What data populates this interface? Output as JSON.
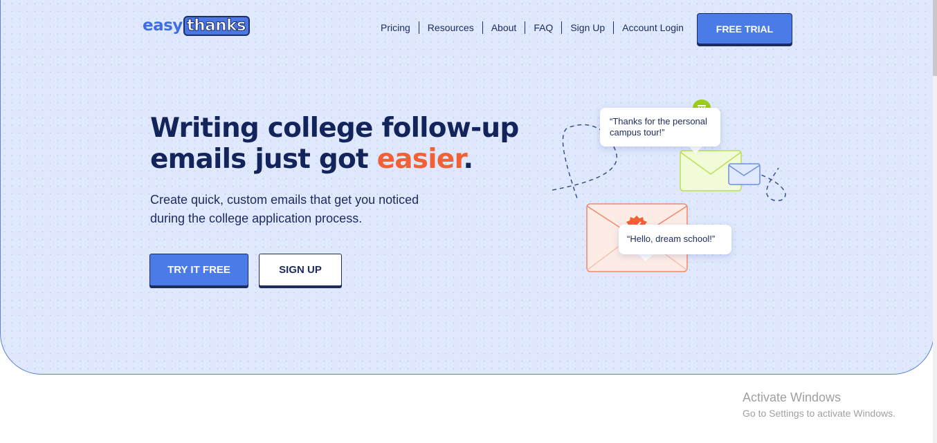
{
  "logo": {
    "easy": "easy",
    "thanks": "thanks"
  },
  "nav": {
    "items": [
      "Pricing",
      "Resources",
      "About",
      "FAQ",
      "Sign Up",
      "Account Login"
    ],
    "cta": "FREE TRIAL"
  },
  "hero": {
    "headline_line1": "Writing college follow-up",
    "headline_line2_start": "emails just got ",
    "headline_accent": "easier",
    "headline_end": ".",
    "subtext": "Create quick, custom emails that get you noticed during the college application process.",
    "primary_button": "TRY IT FREE",
    "secondary_button": "SIGN UP"
  },
  "illustration": {
    "bubble_top": "“Thanks for the personal campus tour!”",
    "bubble_bottom": "“Hello, dream school!”",
    "icons": [
      "building-pin-icon",
      "badge-check-icon",
      "envelope-icon"
    ]
  },
  "watermark": {
    "title": "Activate Windows",
    "subtitle": "Go to Settings to activate Windows."
  },
  "colors": {
    "brand_blue": "#4a7be6",
    "navy": "#13245a",
    "accent_orange": "#f26036",
    "hero_bg": "#dfe8fd"
  }
}
